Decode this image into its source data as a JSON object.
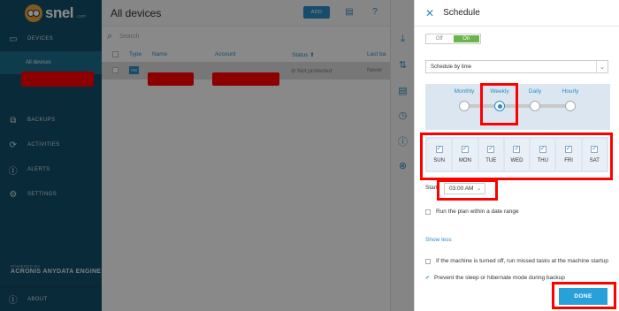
{
  "brand": {
    "name": "snel",
    "suffix": ".com"
  },
  "sidebar": {
    "items": [
      {
        "label": "DEVICES",
        "icon": "monitor-icon"
      },
      {
        "label": "BACKUPS",
        "icon": "copy-icon"
      },
      {
        "label": "ACTIVITIES",
        "icon": "sync-icon"
      },
      {
        "label": "ALERTS",
        "icon": "alert-icon"
      },
      {
        "label": "SETTINGS",
        "icon": "gear-icon"
      }
    ],
    "sub_item": "All devices",
    "powered_by": "POWERED BY",
    "engine": "ACRONIS ANYDATA ENGINE",
    "about": "ABOUT"
  },
  "main": {
    "title": "All devices",
    "add_label": "ADD",
    "search_placeholder": "Search",
    "columns": [
      "Type",
      "Name",
      "Account",
      "Status ⬆",
      "Last ba"
    ],
    "row": {
      "type": "VM",
      "status": "Not protected",
      "last_backup": "Never"
    }
  },
  "panel": {
    "title": "Schedule",
    "toggle_off": "Off",
    "toggle_on": "On",
    "schedule_by": "Schedule by time",
    "frequencies": [
      "Monthly",
      "Weekly",
      "Daily",
      "Hourly"
    ],
    "selected_frequency": "Weekly",
    "days": [
      "SUN",
      "MON",
      "TUE",
      "WED",
      "THU",
      "FRI",
      "SAT"
    ],
    "start_label": "Start",
    "start_time": "03:00 AM",
    "range_label": "Run the plan within a date range",
    "show_less": "Show less",
    "missed_tasks": "If the machine is turned off, run missed tasks at the machine startup",
    "prevent_sleep": "Prevent the sleep or hibernate mode during backup",
    "done_label": "DONE"
  },
  "colors": {
    "sidebar": "#124d66",
    "accent": "#2a8cc3",
    "highlight": "#ff0000",
    "on": "#6bb34a"
  }
}
